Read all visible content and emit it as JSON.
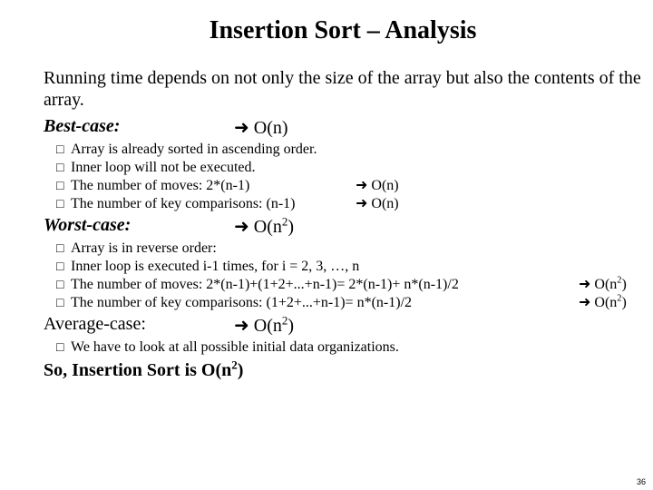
{
  "title": "Insertion Sort – Analysis",
  "intro": "Running time depends on not only the size of the array but also the contents of the array.",
  "arrow": "➜",
  "box": "□",
  "best": {
    "label": "Best-case:",
    "complexity": "O(n)",
    "bullets": [
      {
        "text": "Array is already sorted in ascending order."
      },
      {
        "text": "Inner loop will not be executed."
      },
      {
        "text": "The number of moves: 2*(n-1)",
        "complexity": "O(n)"
      },
      {
        "text": "The number of key comparisons: (n-1)",
        "complexity": "O(n)"
      }
    ]
  },
  "worst": {
    "label": "Worst-case:",
    "complexity_base": "O(n",
    "complexity_exp": "2",
    "complexity_close": ")",
    "bullets": [
      {
        "text": "Array is in reverse order:"
      },
      {
        "text": "Inner loop is executed i-1 times, for i = 2, 3, …, n"
      },
      {
        "text": "The number of moves: 2*(n-1)+(1+2+...+n-1)= 2*(n-1)+ n*(n-1)/2",
        "complexity_base": "O(n",
        "complexity_exp": "2",
        "complexity_close": ")"
      },
      {
        "text": "The number of key comparisons: (1+2+...+n-1)= n*(n-1)/2",
        "complexity_base": "O(n",
        "complexity_exp": "2",
        "complexity_close": ")"
      }
    ]
  },
  "avg": {
    "label": "Average-case:",
    "complexity_base": "O(n",
    "complexity_exp": "2",
    "complexity_close": ")",
    "bullets": [
      {
        "text": "We have to look at all possible initial data organizations."
      }
    ]
  },
  "conclusion_prefix": "So, Insertion Sort is O(n",
  "conclusion_exp": "2",
  "conclusion_close": ")",
  "page_number": "36"
}
